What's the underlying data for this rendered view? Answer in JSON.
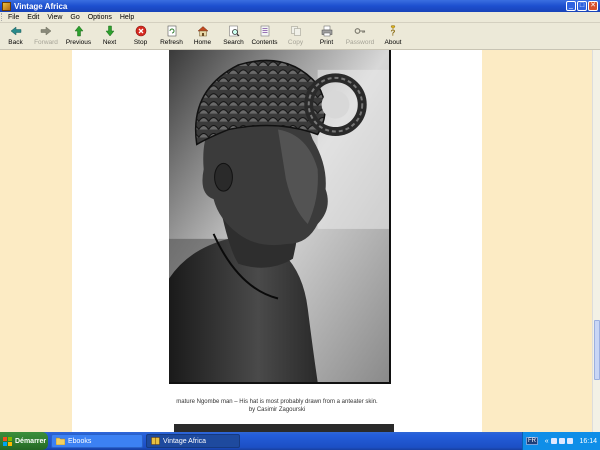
{
  "window": {
    "title": "Vintage Africa",
    "controls": [
      "minimize",
      "maximize",
      "close"
    ]
  },
  "menu": [
    "File",
    "Edit",
    "View",
    "Go",
    "Options",
    "Help"
  ],
  "toolbar": [
    {
      "label": "Back",
      "icon": "back-arrow-icon",
      "enabled": true
    },
    {
      "label": "Forward",
      "icon": "forward-arrow-icon",
      "enabled": false
    },
    {
      "label": "Previous",
      "icon": "previous-arrow-icon",
      "enabled": true
    },
    {
      "label": "Next",
      "icon": "next-arrow-icon",
      "enabled": true
    },
    {
      "label": "Stop",
      "icon": "stop-icon",
      "enabled": true
    },
    {
      "label": "Refresh",
      "icon": "refresh-icon",
      "enabled": true
    },
    {
      "label": "Home",
      "icon": "home-icon",
      "enabled": true
    },
    {
      "label": "Search",
      "icon": "search-icon",
      "enabled": true
    },
    {
      "label": "Contents",
      "icon": "contents-icon",
      "enabled": true
    },
    {
      "label": "Copy",
      "icon": "copy-icon",
      "enabled": false
    },
    {
      "label": "Print",
      "icon": "print-icon",
      "enabled": true
    },
    {
      "label": "Password",
      "icon": "password-key-icon",
      "enabled": false
    },
    {
      "label": "About",
      "icon": "about-icon",
      "enabled": true
    }
  ],
  "content": {
    "caption_line1": "mature Ngombe man – His hat is most probably drawn from a anteater skin.",
    "caption_line2": "by Casimir Zagourski"
  },
  "colors": {
    "page_margin": "#fcebc4",
    "page_bg": "#ffffff",
    "titlebar": "#1d4fcf",
    "taskbar": "#245edb"
  },
  "taskbar": {
    "start_label": "Démarrer",
    "tasks": [
      {
        "label": "Ebooks",
        "icon": "folder-icon",
        "active": false
      },
      {
        "label": "Vintage Africa",
        "icon": "book-icon",
        "active": true
      }
    ],
    "tray": {
      "language": "FR",
      "clock": "16:14"
    }
  }
}
